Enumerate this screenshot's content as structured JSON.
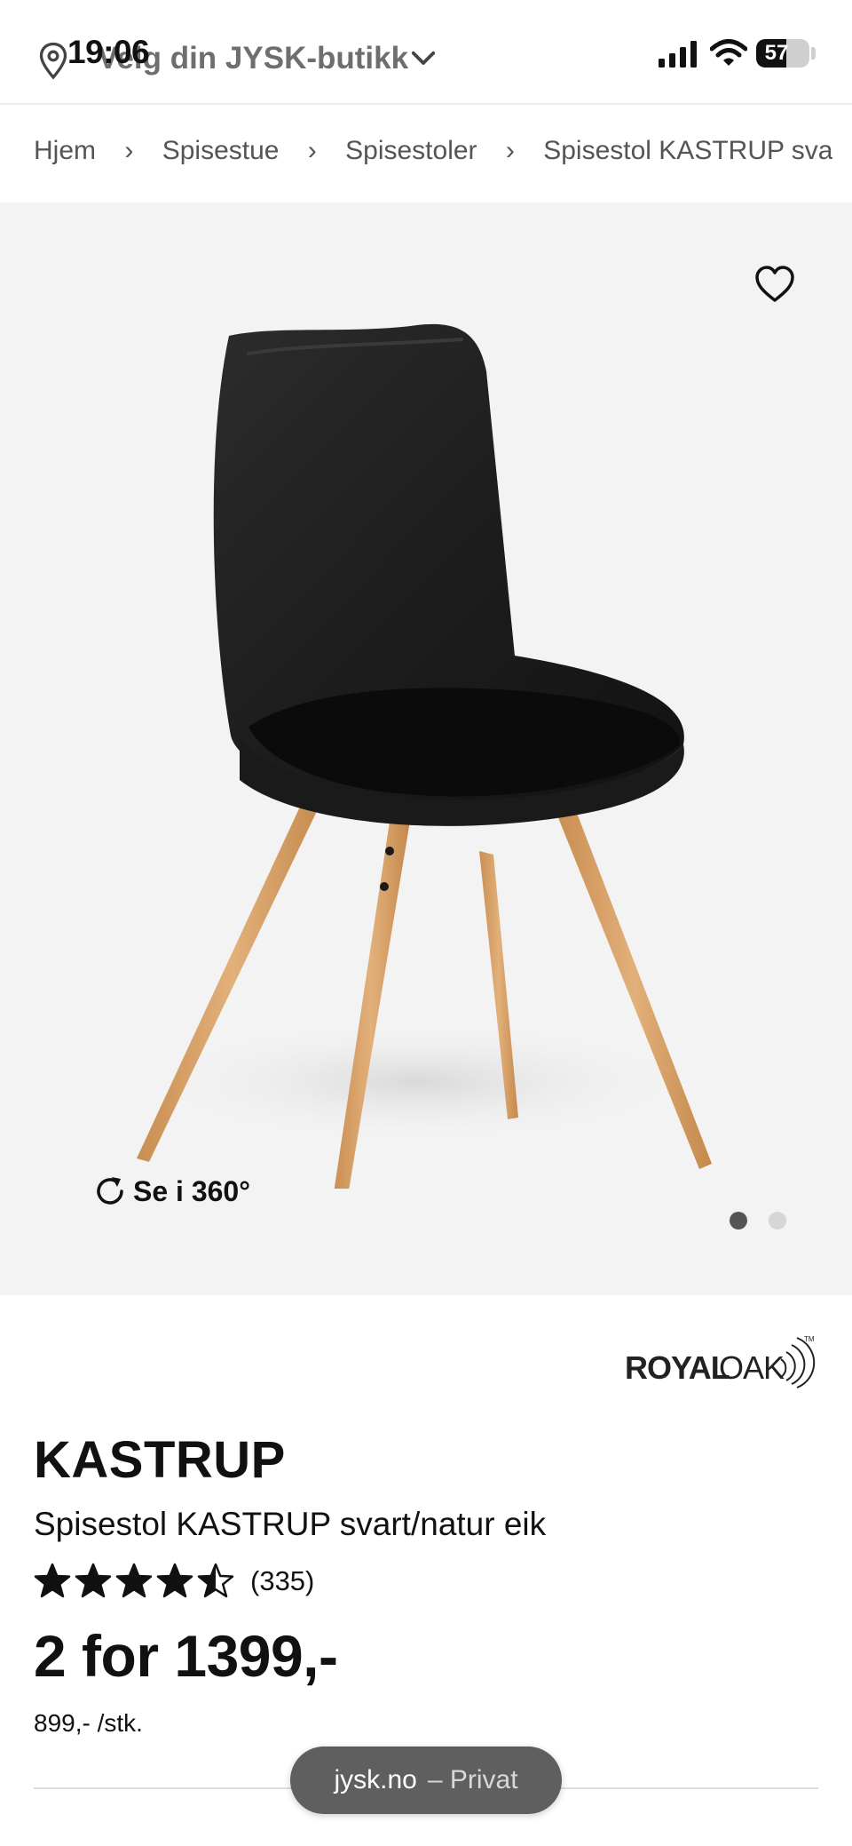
{
  "status_bar": {
    "time": "19:06",
    "battery_percent": 57,
    "battery_label": "57"
  },
  "store_picker": {
    "label": "Velg din JYSK-butikk"
  },
  "breadcrumb": {
    "items": [
      "Hjem",
      "Spisestue",
      "Spisestoler",
      "Spisestol KASTRUP svart/natur eik"
    ],
    "separator": "›"
  },
  "gallery": {
    "view_360_label": "Se i 360°",
    "image_count": 2,
    "active_index": 0
  },
  "product": {
    "brand": "ROYAL OAK",
    "name": "KASTRUP",
    "description": "Spisestol KASTRUP svart/natur eik",
    "rating": 4.5,
    "rating_max": 5,
    "review_count": "(335)",
    "price": "2 for 1399,-",
    "unit_price": "899,- /stk."
  },
  "browser": {
    "domain": "jysk.no",
    "mode": "– Privat"
  },
  "colors": {
    "text": "#111111",
    "muted": "#555555",
    "gallery_bg": "#f3f3f3",
    "chair_shell": "#1c1c1c",
    "chair_legs": "#d9a46b",
    "url_pill": "#5f5f5f"
  },
  "icons": {
    "location": "map-pin-icon",
    "store_dropdown": "chevron-down-icon",
    "favorite": "heart-outline-icon",
    "rotate": "rotate-360-icon"
  }
}
